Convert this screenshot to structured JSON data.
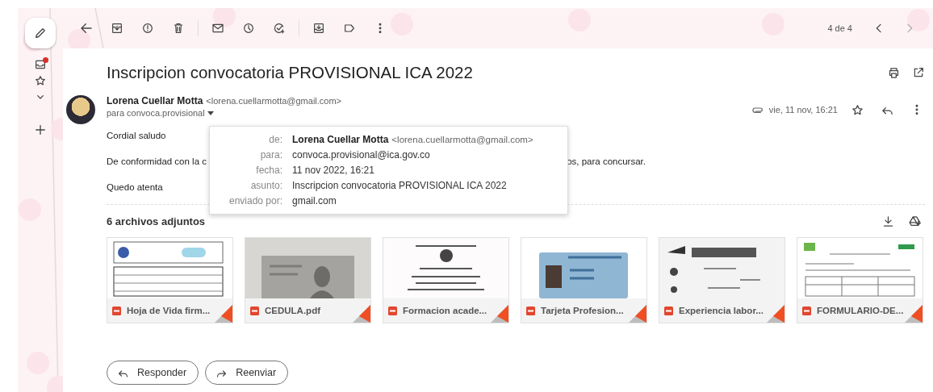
{
  "toolbar": {
    "counter": "4 de 4"
  },
  "subject": "Inscripcion convocatoria PROVISIONAL ICA 2022",
  "sender": {
    "name": "Lorena Cuellar Motta",
    "email": "<lorena.cuellarmotta@gmail.com>",
    "recipients": "para convoca.provisional",
    "date": "vie, 11 nov, 16:21",
    "starred": false
  },
  "body": [
    {
      "text": "Cordial saludo"
    },
    {
      "text": "De conformidad con la c",
      "text_end": "os, para concursar."
    },
    {
      "text": "Quedo atenta"
    }
  ],
  "details_popup": {
    "rows": [
      {
        "label": "de:",
        "value": "Lorena Cuellar Motta",
        "extra": "<lorena.cuellarmotta@gmail.com>"
      },
      {
        "label": "para:",
        "value": "convoca.provisional@ica.gov.co"
      },
      {
        "label": "fecha:",
        "value": "11 nov 2022, 16:21"
      },
      {
        "label": "asunto:",
        "value": "Inscripcion convocatoria PROVISIONAL ICA 2022"
      },
      {
        "label": "enviado por:",
        "value": "gmail.com"
      }
    ]
  },
  "attachments": {
    "title": "6 archivos adjuntos",
    "files": [
      {
        "name": "Hoja de Vida firm..."
      },
      {
        "name": "CEDULA.pdf"
      },
      {
        "name": "Formacion acade..."
      },
      {
        "name": "Tarjeta Profesion..."
      },
      {
        "name": "Experiencia labor..."
      },
      {
        "name": "FORMULARIO-DE..."
      }
    ]
  },
  "actions": [
    "Responder",
    "Reenviar"
  ]
}
